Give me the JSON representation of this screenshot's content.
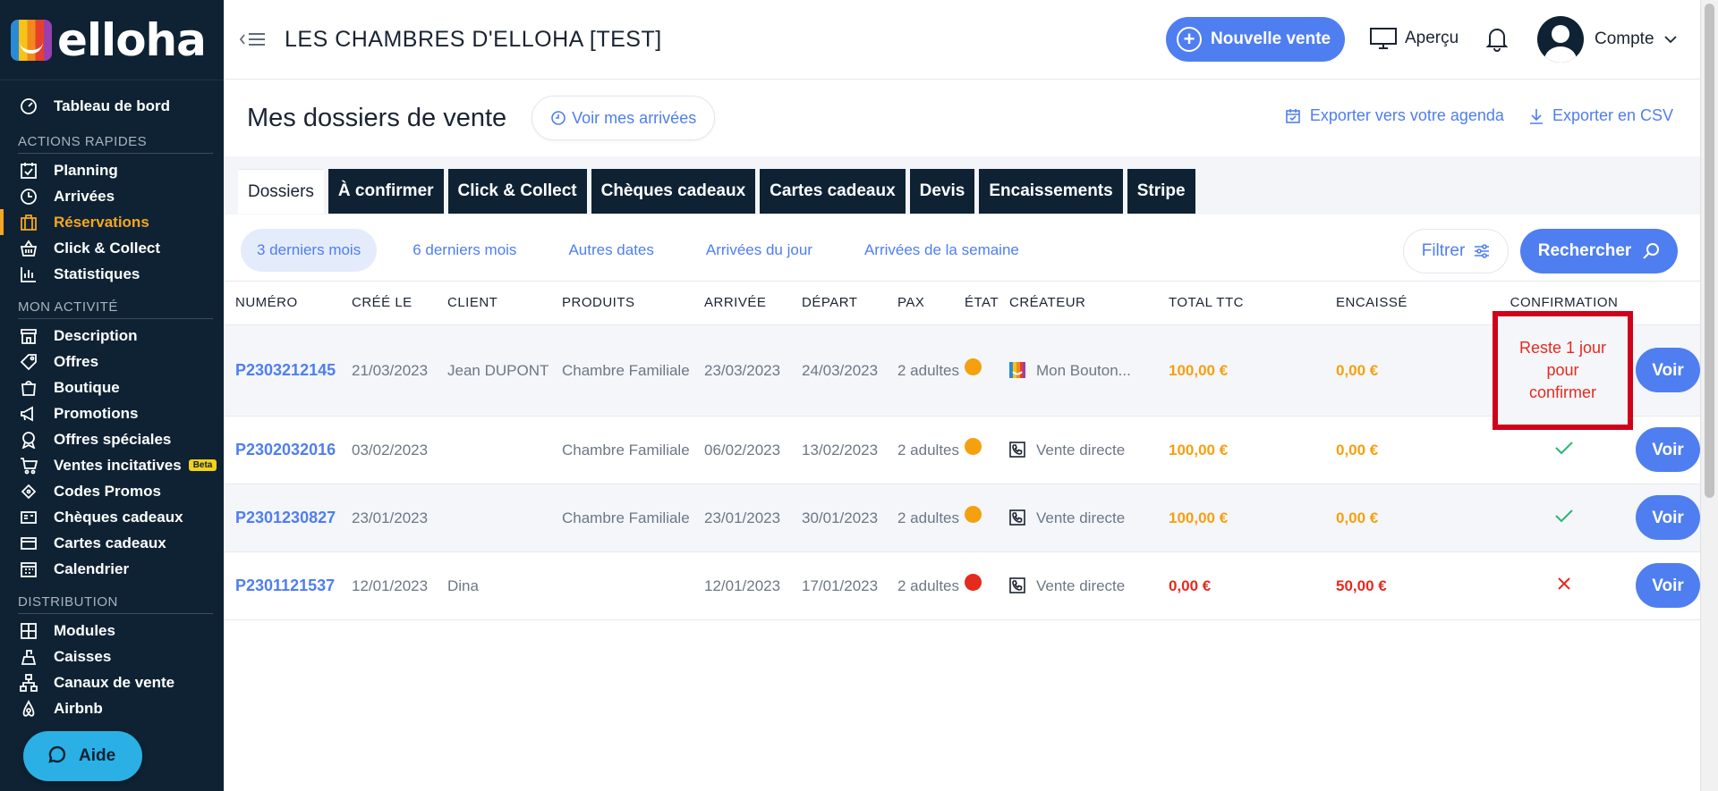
{
  "brand": {
    "logo_text": "elloha"
  },
  "sidebar": {
    "dashboard": "Tableau de bord",
    "sections": [
      {
        "title": "ACTIONS RAPIDES",
        "items": [
          "Planning",
          "Arrivées",
          "Réservations",
          "Click & Collect",
          "Statistiques"
        ]
      },
      {
        "title": "MON ACTIVITÉ",
        "items": [
          "Description",
          "Offres",
          "Boutique",
          "Promotions",
          "Offres spéciales",
          "Ventes incitatives",
          "Codes Promos",
          "Chèques cadeaux",
          "Cartes cadeaux",
          "Calendrier"
        ]
      },
      {
        "title": "DISTRIBUTION",
        "items": [
          "Modules",
          "Caisses",
          "Canaux de vente",
          "Airbnb"
        ]
      }
    ],
    "beta_badge": "Beta",
    "active_item": "Réservations",
    "help_label": "Aide"
  },
  "header": {
    "hotel_name": "LES CHAMBRES D'ELLOHA [TEST]",
    "new_sale": "Nouvelle vente",
    "preview": "Aperçu",
    "account": "Compte"
  },
  "page": {
    "title": "Mes dossiers de vente",
    "arrivals_button": "Voir mes arrivées",
    "export_agenda": "Exporter vers votre agenda",
    "export_csv": "Exporter en CSV"
  },
  "tabs": [
    "Dossiers",
    "À confirmer",
    "Click & Collect",
    "Chèques cadeaux",
    "Cartes cadeaux",
    "Devis",
    "Encaissements",
    "Stripe"
  ],
  "periods": [
    "3 derniers mois",
    "6 derniers mois",
    "Autres dates",
    "Arrivées du jour",
    "Arrivées de la semaine"
  ],
  "filter_label": "Filtrer",
  "search_label": "Rechercher",
  "table": {
    "headers": [
      "NUMÉRO",
      "CRÉÉ LE",
      "CLIENT",
      "PRODUITS",
      "ARRIVÉE",
      "DÉPART",
      "PAX",
      "ÉTAT",
      "CRÉATEUR",
      "TOTAL TTC",
      "ENCAISSÉ",
      "CONFIRMATION"
    ],
    "rows": [
      {
        "numero": "P2303212145",
        "cree": "21/03/2023",
        "client": "Jean DUPONT",
        "produit": "Chambre Familiale",
        "arrivee": "23/03/2023",
        "depart": "24/03/2023",
        "pax": "2 adultes",
        "etat_color": "#f5a00e",
        "createur": "Mon Bouton...",
        "createur_icon": "elloha-button-icon",
        "total": "100,00 €",
        "encaisse": "0,00 €",
        "confirmation": "Reste 1 jour pour confirmer",
        "voir": "Voir"
      },
      {
        "numero": "P2302032016",
        "cree": "03/02/2023",
        "client": "",
        "produit": "Chambre Familiale",
        "arrivee": "06/02/2023",
        "depart": "13/02/2023",
        "pax": "2 adultes",
        "etat_color": "#f5a00e",
        "createur": "Vente directe",
        "createur_icon": "phone-icon",
        "total": "100,00 €",
        "encaisse": "0,00 €",
        "confirmation": "check",
        "voir": "Voir"
      },
      {
        "numero": "P2301230827",
        "cree": "23/01/2023",
        "client": "",
        "produit": "Chambre Familiale",
        "arrivee": "23/01/2023",
        "depart": "30/01/2023",
        "pax": "2 adultes",
        "etat_color": "#f5a00e",
        "createur": "Vente directe",
        "createur_icon": "phone-icon",
        "total": "100,00 €",
        "encaisse": "0,00 €",
        "confirmation": "check",
        "voir": "Voir"
      },
      {
        "numero": "P2301121537",
        "cree": "12/01/2023",
        "client": "Dina",
        "produit": "",
        "arrivee": "12/01/2023",
        "depart": "17/01/2023",
        "pax": "2 adultes",
        "etat_color": "#e52a1e",
        "createur": "Vente directe",
        "createur_icon": "phone-icon",
        "total": "0,00 €",
        "encaisse": "50,00 €",
        "confirmation": "cross",
        "voir": "Voir"
      }
    ]
  }
}
